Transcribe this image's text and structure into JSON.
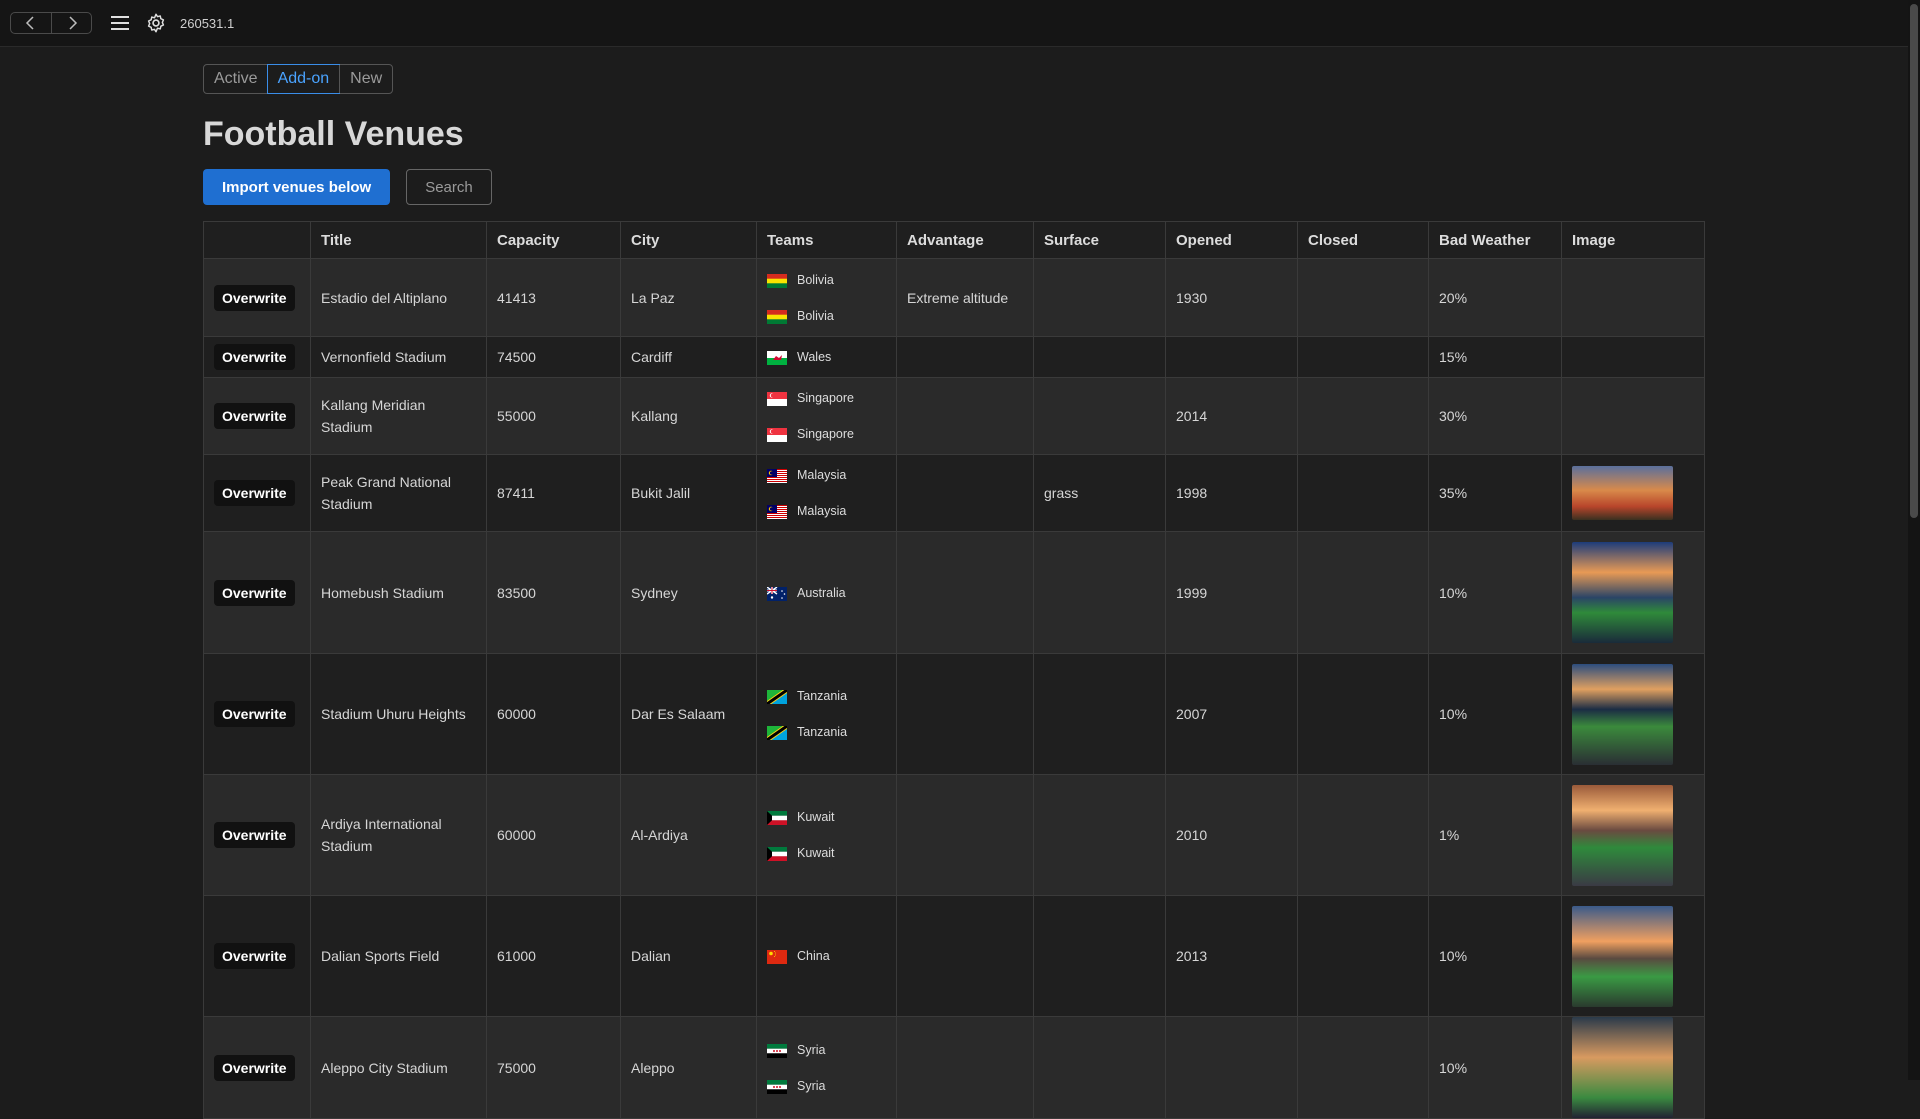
{
  "app": {
    "version": "260531.1"
  },
  "tabs": [
    {
      "label": "Active",
      "active": false
    },
    {
      "label": "Add-on",
      "active": true
    },
    {
      "label": "New",
      "active": false
    }
  ],
  "page": {
    "title": "Football Venues"
  },
  "actions": {
    "import_label": "Import venues below",
    "search_label": "Search"
  },
  "table": {
    "columns": [
      "",
      "Title",
      "Capacity",
      "City",
      "Teams",
      "Advantage",
      "Surface",
      "Opened",
      "Closed",
      "Bad Weather",
      "Image"
    ],
    "row_action_label": "Overwrite",
    "rows": [
      {
        "title": "Estadio del Altiplano",
        "capacity": "41413",
        "city": "La Paz",
        "teams": [
          "Bolivia",
          "Bolivia"
        ],
        "advantage": "Extreme altitude",
        "surface": "",
        "opened": "1930",
        "closed": "",
        "bad_weather": "20%",
        "image": null
      },
      {
        "title": "Vernonfield Stadium",
        "capacity": "74500",
        "city": "Cardiff",
        "teams": [
          "Wales"
        ],
        "advantage": "",
        "surface": "",
        "opened": "",
        "closed": "",
        "bad_weather": "15%",
        "image": null
      },
      {
        "title": "Kallang Meridian Stadium",
        "capacity": "55000",
        "city": "Kallang",
        "teams": [
          "Singapore",
          "Singapore"
        ],
        "advantage": "",
        "surface": "",
        "opened": "2014",
        "closed": "",
        "bad_weather": "30%",
        "image": null
      },
      {
        "title": "Peak Grand National Stadium",
        "capacity": "87411",
        "city": "Bukit Jalil",
        "teams": [
          "Malaysia",
          "Malaysia"
        ],
        "advantage": "",
        "surface": "grass",
        "opened": "1998",
        "closed": "",
        "bad_weather": "35%",
        "image": "stadium-photo-wide"
      },
      {
        "title": "Homebush Stadium",
        "capacity": "83500",
        "city": "Sydney",
        "teams": [
          "Australia"
        ],
        "advantage": "",
        "surface": "",
        "opened": "1999",
        "closed": "",
        "bad_weather": "10%",
        "image": "stadium-photo-dusk"
      },
      {
        "title": "Stadium Uhuru Heights",
        "capacity": "60000",
        "city": "Dar Es Salaam",
        "teams": [
          "Tanzania",
          "Tanzania"
        ],
        "advantage": "",
        "surface": "",
        "opened": "2007",
        "closed": "",
        "bad_weather": "10%",
        "image": "stadium-photo-night"
      },
      {
        "title": "Ardiya International Stadium",
        "capacity": "60000",
        "city": "Al-Ardiya",
        "teams": [
          "Kuwait",
          "Kuwait"
        ],
        "advantage": "",
        "surface": "",
        "opened": "2010",
        "closed": "",
        "bad_weather": "1%",
        "image": "stadium-photo-sunset"
      },
      {
        "title": "Dalian Sports Field",
        "capacity": "61000",
        "city": "Dalian",
        "teams": [
          "China"
        ],
        "advantage": "",
        "surface": "",
        "opened": "2013",
        "closed": "",
        "bad_weather": "10%",
        "image": "stadium-photo-sunrise"
      },
      {
        "title": "Aleppo City Stadium",
        "capacity": "75000",
        "city": "Aleppo",
        "teams": [
          "Syria",
          "Syria"
        ],
        "advantage": "",
        "surface": "",
        "opened": "",
        "closed": "",
        "bad_weather": "10%",
        "image": "stadium-photo-evening"
      }
    ]
  },
  "colors": {
    "accent": "#1f6fd1",
    "tab_active": "#4aa3ff"
  }
}
